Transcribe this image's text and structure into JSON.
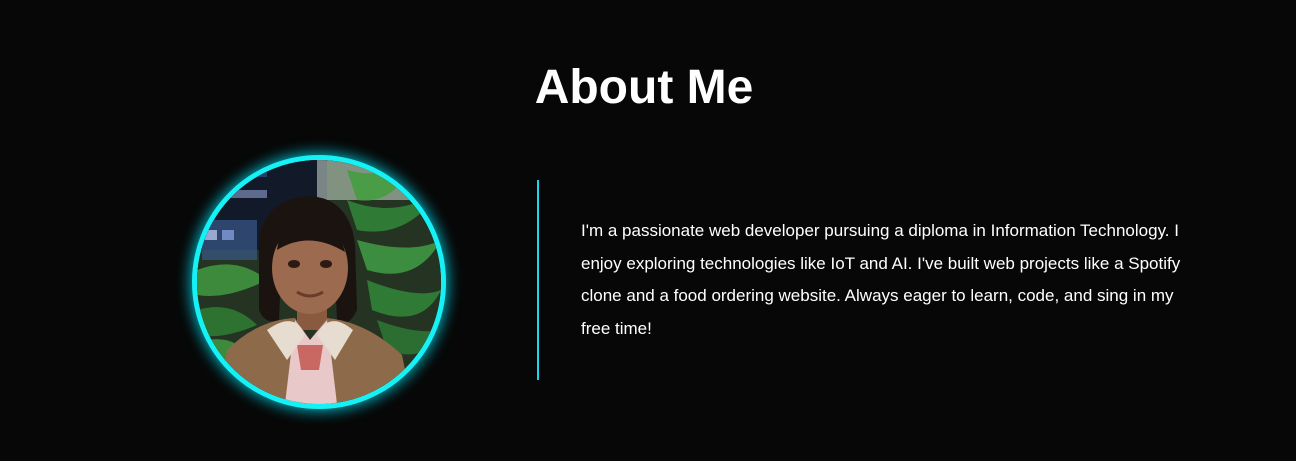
{
  "about": {
    "title": "About Me",
    "bio": "I'm a passionate web developer pursuing a diploma in Information Technology. I enjoy exploring technologies like IoT and AI. I've built web projects like a Spotify clone and a food ordering website. Always eager to learn, code, and sing in my free time!",
    "photo_icon": "profile-photo"
  },
  "colors": {
    "background": "#070707",
    "accent": "#16f1f5",
    "text": "#ffffff"
  }
}
